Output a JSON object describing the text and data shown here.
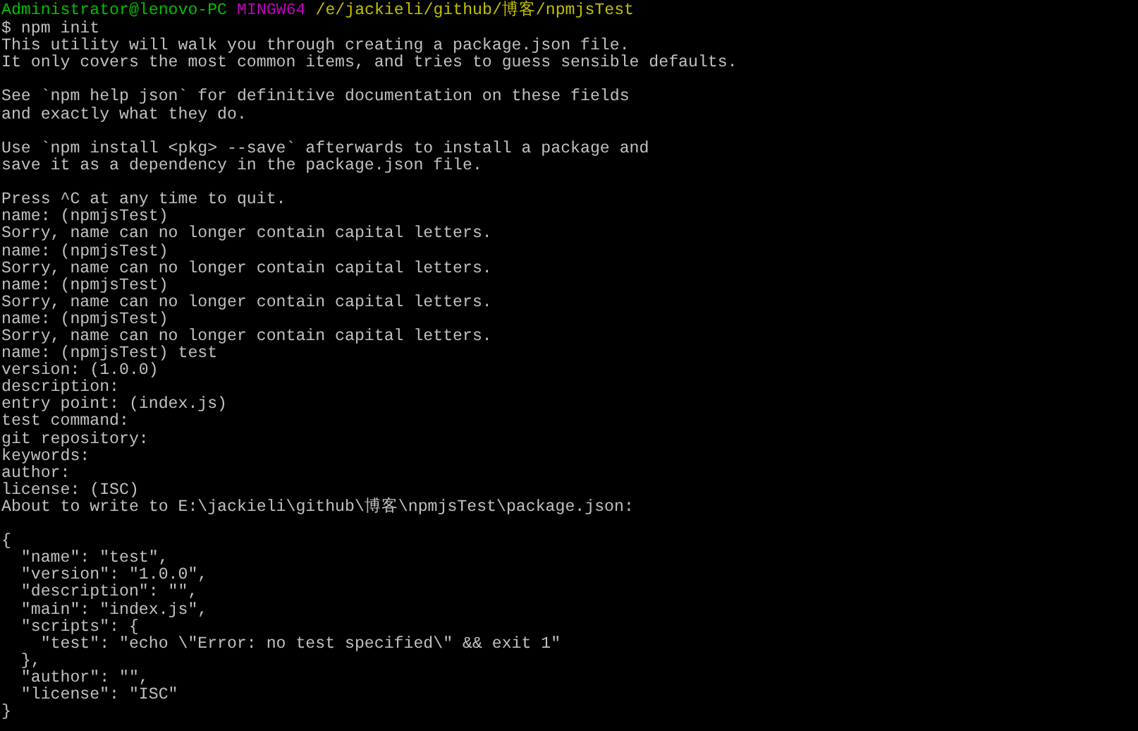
{
  "prompt": {
    "segments": [
      {
        "text": "Administrator@lenovo-PC",
        "color": "#00c000"
      },
      {
        "text": "MINGW64",
        "color": "#c000c0"
      },
      {
        "text": "/e/jackieli/github/博客/npmjsTest",
        "color": "#c0c000"
      }
    ]
  },
  "command": "$ npm init",
  "output_blocks": [
    [
      "This utility will walk you through creating a package.json file.",
      "It only covers the most common items, and tries to guess sensible defaults."
    ],
    [
      "See `npm help json` for definitive documentation on these fields",
      "and exactly what they do."
    ],
    [
      "Use `npm install <pkg> --save` afterwards to install a package and",
      "save it as a dependency in the package.json file."
    ],
    [
      "Press ^C at any time to quit.",
      "name: (npmjsTest)",
      "Sorry, name can no longer contain capital letters.",
      "name: (npmjsTest)",
      "Sorry, name can no longer contain capital letters.",
      "name: (npmjsTest)",
      "Sorry, name can no longer contain capital letters.",
      "name: (npmjsTest)",
      "Sorry, name can no longer contain capital letters.",
      "name: (npmjsTest) test",
      "version: (1.0.0)",
      "description:",
      "entry point: (index.js)",
      "test command:",
      "git repository:",
      "keywords:",
      "author:",
      "license: (ISC)",
      "About to write to E:\\jackieli\\github\\博客\\npmjsTest\\package.json:"
    ],
    [
      "{",
      "  \"name\": \"test\",",
      "  \"version\": \"1.0.0\",",
      "  \"description\": \"\",",
      "  \"main\": \"index.js\",",
      "  \"scripts\": {",
      "    \"test\": \"echo \\\"Error: no test specified\\\" && exit 1\"",
      "  },",
      "  \"author\": \"\",",
      "  \"license\": \"ISC\"",
      "}"
    ]
  ]
}
